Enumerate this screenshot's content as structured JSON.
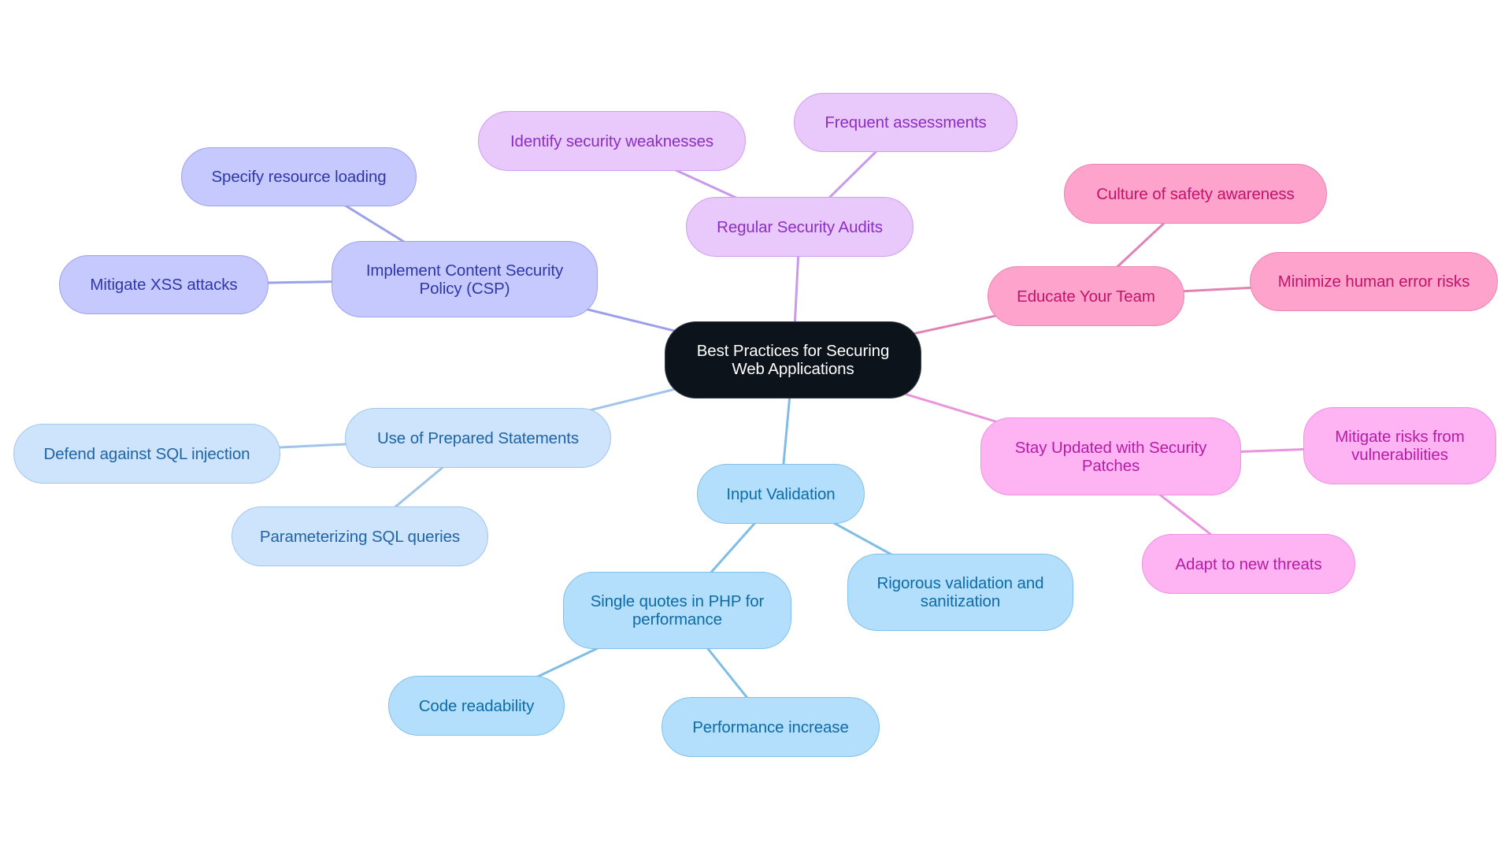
{
  "mindmap": {
    "root": {
      "id": "root",
      "label": "Best Practices for Securing Web Applications",
      "lines": [
        "Best Practices for Securing",
        "Web Applications"
      ]
    },
    "branches": [
      {
        "id": "csp",
        "label": "Implement Content Security Policy (CSP)",
        "lines": [
          "Implement Content Security",
          "Policy (CSP)"
        ],
        "edge_color": "#9ca0ea",
        "children": [
          {
            "id": "csp-1",
            "label": "Specify resource loading",
            "lines": [
              "Specify resource loading"
            ]
          },
          {
            "id": "csp-2",
            "label": "Mitigate XSS attacks",
            "lines": [
              "Mitigate XSS attacks"
            ]
          }
        ]
      },
      {
        "id": "audit",
        "label": "Regular Security Audits",
        "lines": [
          "Regular Security Audits"
        ],
        "edge_color": "#c89aec",
        "children": [
          {
            "id": "audit-1",
            "label": "Identify security weaknesses",
            "lines": [
              "Identify security weaknesses"
            ]
          },
          {
            "id": "audit-2",
            "label": "Frequent assessments",
            "lines": [
              "Frequent assessments"
            ]
          }
        ]
      },
      {
        "id": "edu",
        "label": "Educate Your Team",
        "lines": [
          "Educate Your Team"
        ],
        "edge_color": "#e183b2",
        "children": [
          {
            "id": "edu-1",
            "label": "Culture of safety awareness",
            "lines": [
              "Culture of safety awareness"
            ]
          },
          {
            "id": "edu-2",
            "label": "Minimize human error risks",
            "lines": [
              "Minimize human error risks"
            ]
          }
        ]
      },
      {
        "id": "patch",
        "label": "Stay Updated with Security Patches",
        "lines": [
          "Stay Updated with Security",
          "Patches"
        ],
        "edge_color": "#eb94de",
        "children": [
          {
            "id": "patch-1",
            "label": "Mitigate risks from vulnerabilities",
            "lines": [
              "Mitigate risks from",
              "vulnerabilities"
            ]
          },
          {
            "id": "patch-2",
            "label": "Adapt to new threats",
            "lines": [
              "Adapt to new threats"
            ]
          }
        ]
      },
      {
        "id": "input",
        "label": "Input Validation",
        "lines": [
          "Input Validation"
        ],
        "edge_color": "#7fbde6",
        "children": [
          {
            "id": "input-1",
            "label": "Single quotes in PHP for performance",
            "lines": [
              "Single quotes in PHP for",
              "performance"
            ],
            "children": [
              {
                "id": "input-1-1",
                "label": "Code readability",
                "lines": [
                  "Code readability"
                ]
              },
              {
                "id": "input-1-2",
                "label": "Performance increase",
                "lines": [
                  "Performance increase"
                ]
              }
            ]
          },
          {
            "id": "input-2",
            "label": "Rigorous validation and sanitization",
            "lines": [
              "Rigorous validation and",
              "sanitization"
            ]
          }
        ]
      },
      {
        "id": "prep",
        "label": "Use of Prepared Statements",
        "lines": [
          "Use of Prepared Statements"
        ],
        "edge_color": "#a0c4ea",
        "children": [
          {
            "id": "prep-1",
            "label": "Defend against SQL injection",
            "lines": [
              "Defend against SQL injection"
            ]
          },
          {
            "id": "prep-2",
            "label": "Parameterizing SQL queries",
            "lines": [
              "Parameterizing SQL queries"
            ]
          }
        ]
      }
    ]
  }
}
